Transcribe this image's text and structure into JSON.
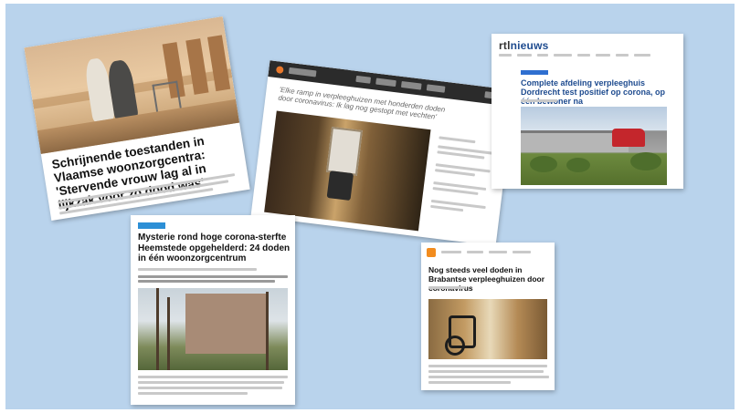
{
  "background_color": "#b9d3ec",
  "articles": [
    {
      "headline": "Schrijnende toestanden in Vlaamse woonzorgcentra: 'Stervende vrouw lag al in lijkzak voor zo dood was'"
    },
    {
      "subheadline": "'Elke ramp in verpleeghuizen met honderden doden door coronavirus: Ik lag nog gestopt met vechten'"
    },
    {
      "brand_prefix": "rtl",
      "brand_name": "nieuws",
      "headline": "Complete afdeling verpleeghuis Dordrecht test positief op corona, op één bewoner na"
    },
    {
      "headline": "Mysterie rond hoge corona-sterfte Heemstede opgehelderd: 24 doden in één woonzorgcentrum"
    },
    {
      "headline": "Nog steeds veel doden in Brabantse verpleeghuizen door coronavirus"
    }
  ]
}
